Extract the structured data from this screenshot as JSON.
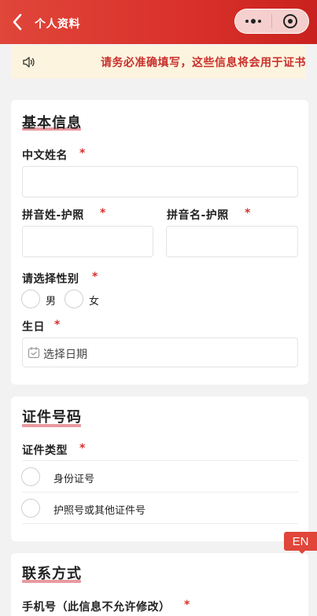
{
  "header": {
    "title": "个人资料"
  },
  "notice": {
    "text": "请务必准确填写，这些信息将会用于证书"
  },
  "basic": {
    "title": "基本信息",
    "chinese_name_label": "中文姓名",
    "pinyin_surname_label": "拼音姓-护照",
    "pinyin_given_label": "拼音名-护照",
    "gender_label": "请选择性别",
    "gender_options": [
      "男",
      "女"
    ],
    "birthday_label": "生日",
    "birthday_placeholder": "选择日期",
    "required_mark": "*"
  },
  "id": {
    "title": "证件号码",
    "type_label": "证件类型",
    "options": [
      "身份证号",
      "护照号或其他证件号"
    ]
  },
  "contact": {
    "title": "联系方式",
    "phone_label": "手机号（此信息不允许修改）"
  },
  "lang_badge": "EN",
  "colors": {
    "header": "#d9302a",
    "accent": "#d9302a",
    "notice_bg": "#fdf4df",
    "underline": "#e89aa0"
  }
}
